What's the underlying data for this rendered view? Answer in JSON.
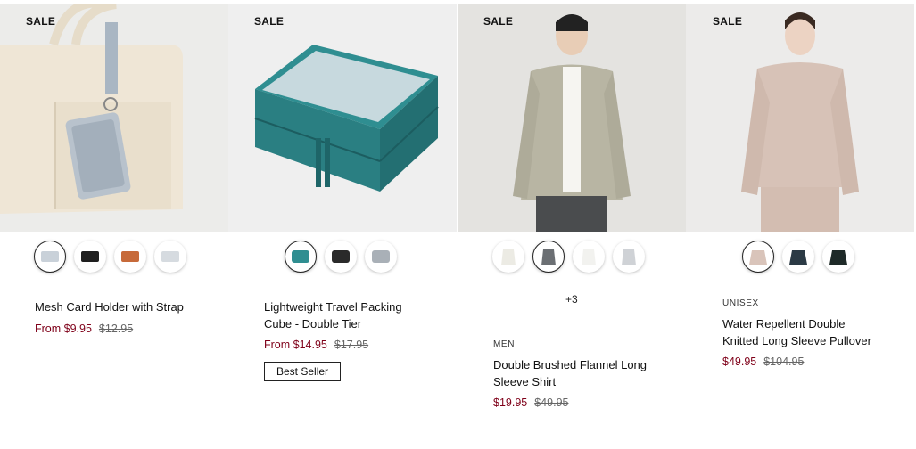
{
  "products": [
    {
      "sale_label": "SALE",
      "name": "Mesh Card Holder with Strap",
      "price_now": "From $9.95",
      "price_was": "$12.95",
      "image_icon": "mesh-card-holder-image",
      "swatches": [
        "#c9d1d9",
        "#1f1f1f",
        "#c76a3a",
        "#d6dbe0"
      ]
    },
    {
      "sale_label": "SALE",
      "name_lines": [
        "Lightweight Travel Packing",
        "Cube - Double Tier"
      ],
      "price_now": "From $14.95",
      "price_was": "$17.95",
      "badge": "Best Seller",
      "image_icon": "packing-cube-image",
      "swatches": [
        "#2f8e91",
        "#2a2a2a",
        "#a9b0b7"
      ]
    },
    {
      "sale_label": "SALE",
      "more_colors": "+3",
      "category": "MEN",
      "name_lines": [
        "Double Brushed Flannel Long",
        "Sleeve Shirt"
      ],
      "price_now": "$19.95",
      "price_was": "$49.95",
      "image_icon": "flannel-shirt-image",
      "swatches": [
        "#ecebe4",
        "#6b6f73",
        "#f2f2ef",
        "#cfd2d6"
      ]
    },
    {
      "sale_label": "SALE",
      "category": "UNISEX",
      "name_lines": [
        "Water Repellent Double",
        "Knitted Long Sleeve Pullover"
      ],
      "price_now": "$49.95",
      "price_was": "$104.95",
      "image_icon": "pullover-image",
      "swatches": [
        "#d9c4ba",
        "#2b3a45",
        "#1e2a28"
      ]
    }
  ]
}
